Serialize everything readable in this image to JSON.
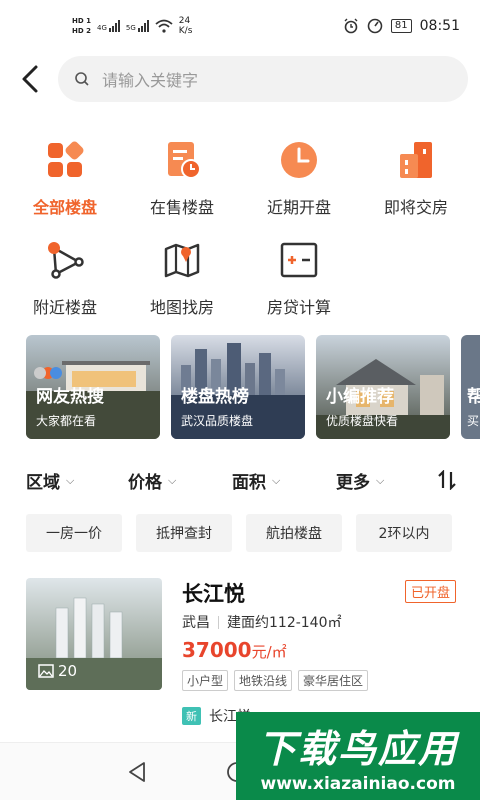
{
  "status": {
    "hd1": "HD 1",
    "hd2": "HD 2",
    "net1": "4G",
    "net2": "5G",
    "speed_value": "24",
    "speed_unit": "K/s",
    "battery": "81",
    "time": "08:51"
  },
  "search": {
    "placeholder": "请输入关键字"
  },
  "categories": [
    {
      "label": "全部楼盘",
      "icon": "grid-icon",
      "active": true
    },
    {
      "label": "在售楼盘",
      "icon": "document-clock-icon"
    },
    {
      "label": "近期开盘",
      "icon": "clock-icon"
    },
    {
      "label": "即将交房",
      "icon": "buildings-icon"
    },
    {
      "label": "附近楼盘",
      "icon": "location-network-icon"
    },
    {
      "label": "地图找房",
      "icon": "map-icon"
    },
    {
      "label": "房贷计算",
      "icon": "calculator-icon"
    }
  ],
  "banners": [
    {
      "title": "网友热搜",
      "subtitle": "大家都在看"
    },
    {
      "title": "楼盘热榜",
      "subtitle": "武汉品质楼盘"
    },
    {
      "title": "小编推荐",
      "subtitle": "优质楼盘快看"
    },
    {
      "title": "帮",
      "subtitle": "买"
    }
  ],
  "filters": [
    {
      "label": "区域"
    },
    {
      "label": "价格"
    },
    {
      "label": "面积"
    },
    {
      "label": "更多"
    }
  ],
  "chips": [
    "一房一价",
    "抵押查封",
    "航拍楼盘",
    "2环以内"
  ],
  "listing": {
    "title": "长江悦",
    "status": "已开盘",
    "district": "武昌",
    "area": "建面约112-140㎡",
    "price": "37000",
    "price_unit": "元/㎡",
    "photo_count": "20",
    "tags": [
      "小户型",
      "地铁沿线",
      "豪华居住区"
    ],
    "news_badge": "新",
    "news_text": "长江悦"
  },
  "watermark": {
    "title": "下载鸟应用",
    "url": "www.xiazainiao.com"
  },
  "colors": {
    "accent": "#f0642c",
    "price": "#e8452c",
    "watermark": "#0a8a4a"
  }
}
